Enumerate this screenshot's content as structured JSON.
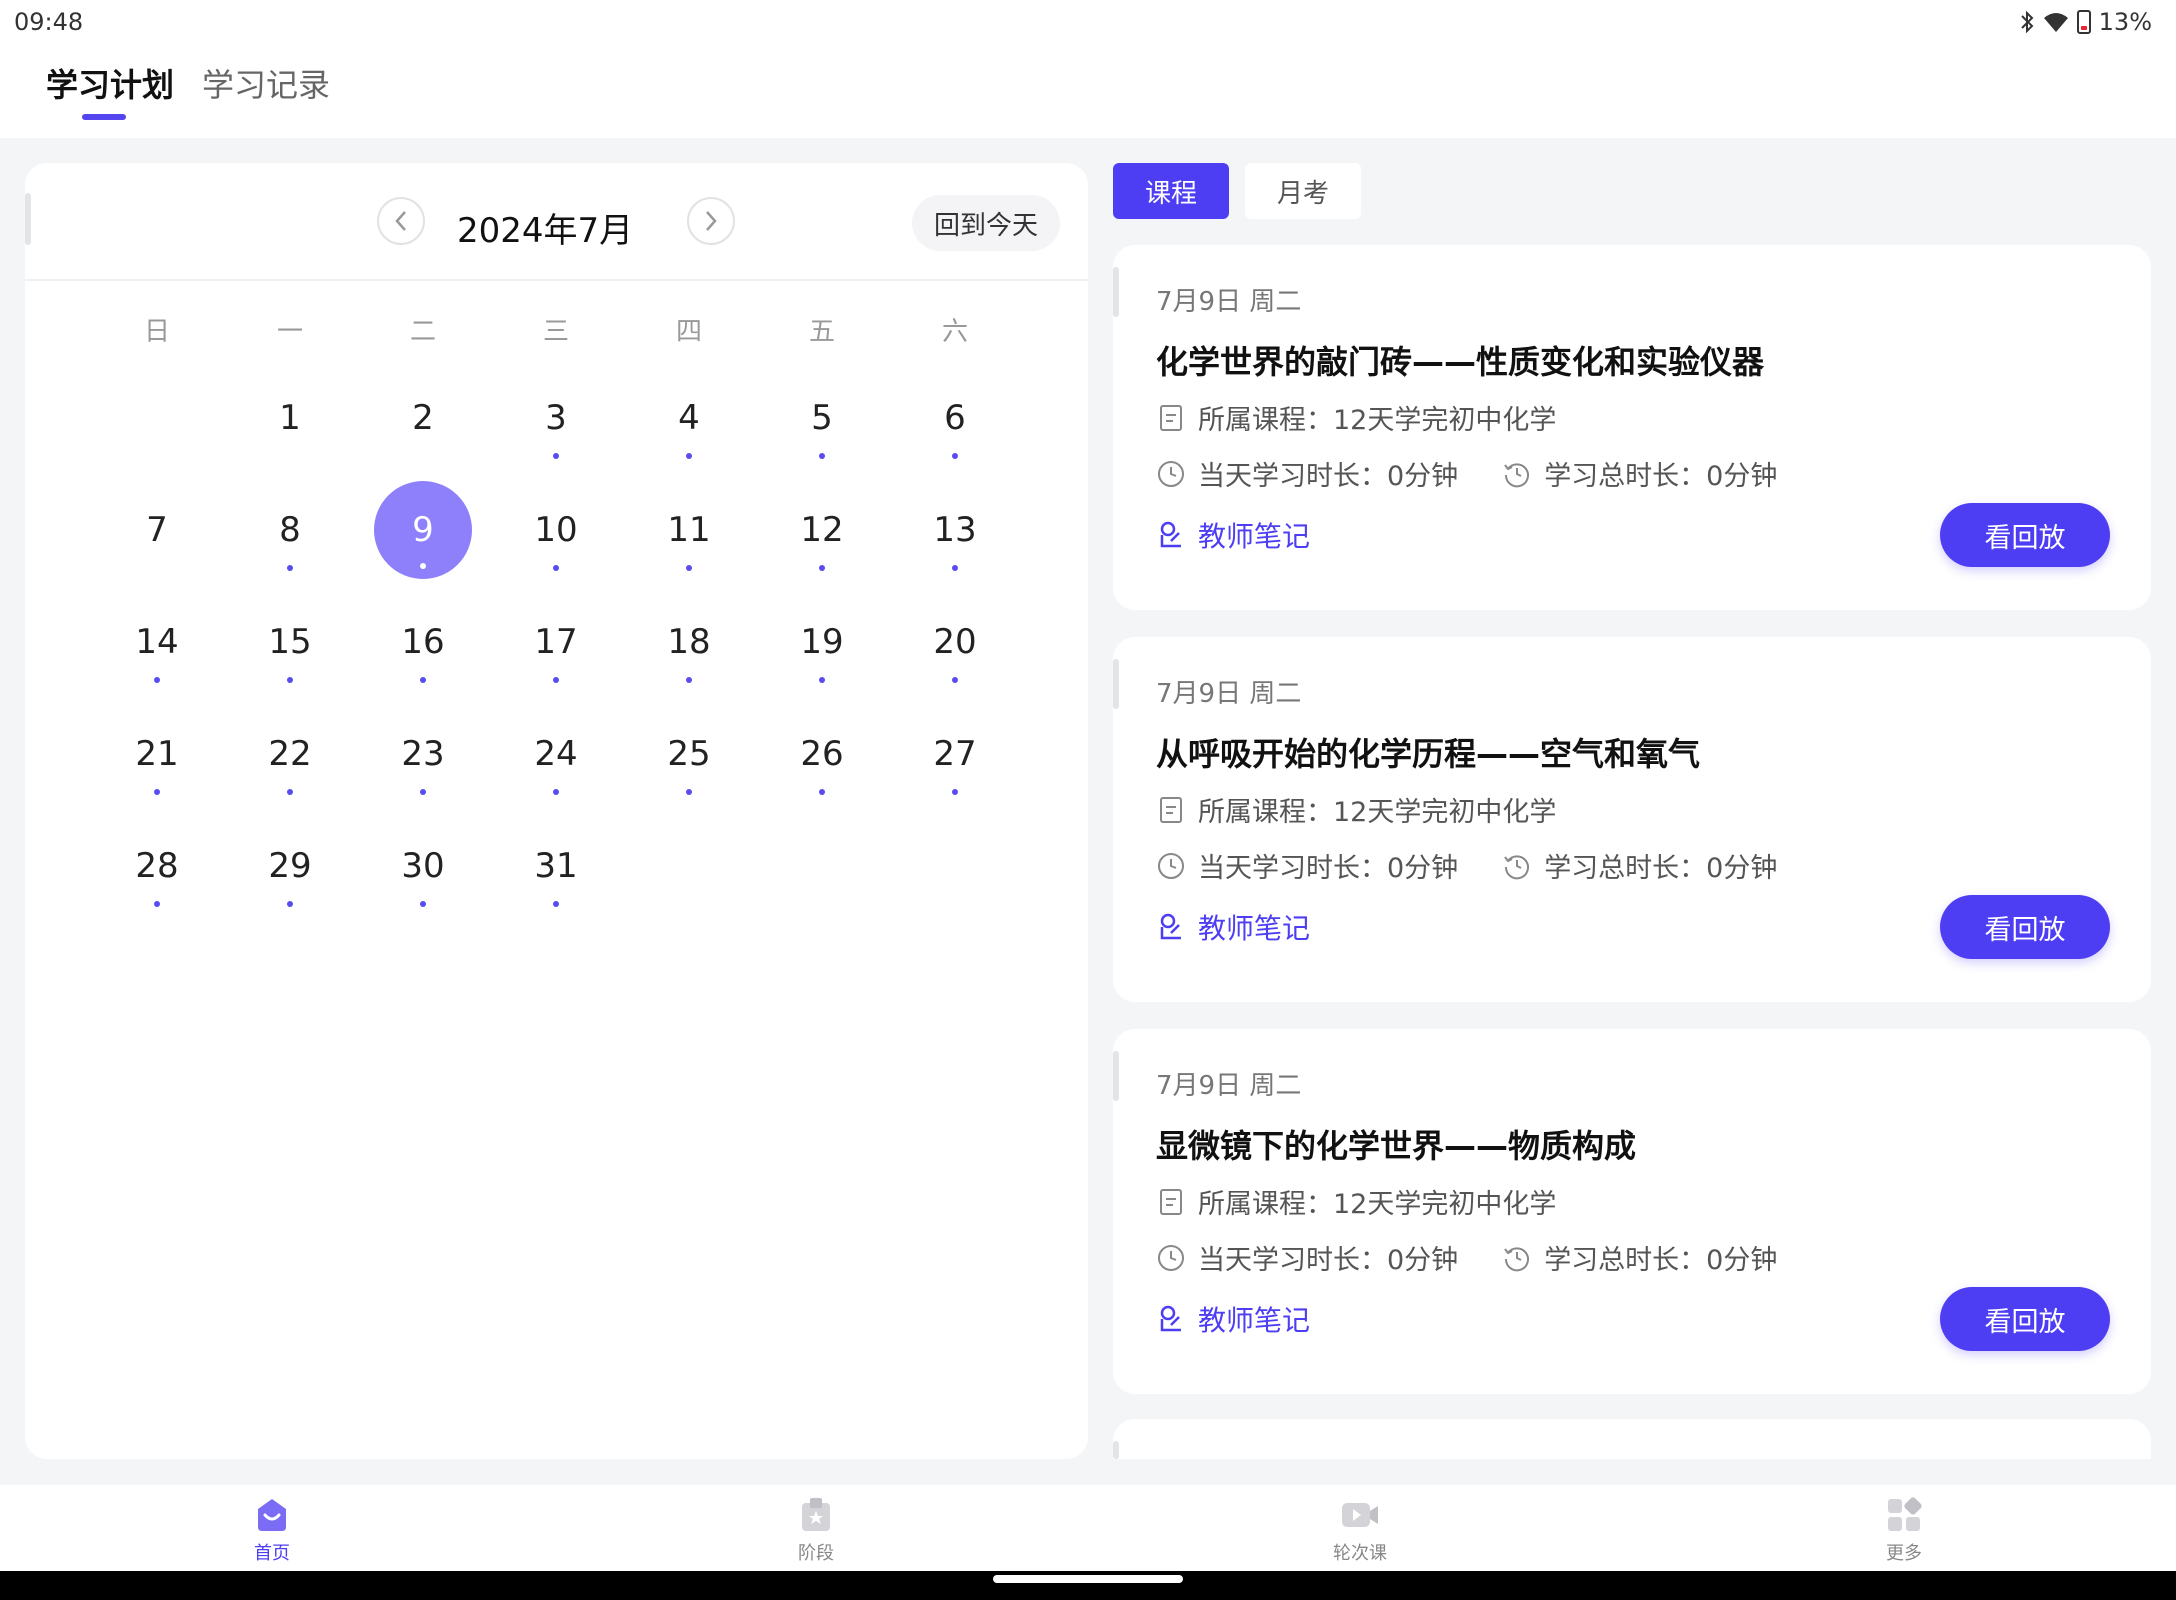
{
  "status_bar": {
    "time": "09:48",
    "battery": "13%"
  },
  "top_tabs": [
    {
      "label": "学习计划",
      "active": true
    },
    {
      "label": "学习记录",
      "active": false
    }
  ],
  "calendar": {
    "month_title": "2024年7月",
    "back_today": "回到今天",
    "weekdays": [
      "日",
      "一",
      "二",
      "三",
      "四",
      "五",
      "六"
    ],
    "selected_day": "9",
    "weeks": [
      [
        null,
        {
          "d": "1",
          "dot": false
        },
        {
          "d": "2",
          "dot": false
        },
        {
          "d": "3",
          "dot": true
        },
        {
          "d": "4",
          "dot": true
        },
        {
          "d": "5",
          "dot": true
        },
        {
          "d": "6",
          "dot": true
        }
      ],
      [
        {
          "d": "7",
          "dot": false
        },
        {
          "d": "8",
          "dot": true
        },
        {
          "d": "9",
          "dot": true
        },
        {
          "d": "10",
          "dot": true
        },
        {
          "d": "11",
          "dot": true
        },
        {
          "d": "12",
          "dot": true
        },
        {
          "d": "13",
          "dot": true
        }
      ],
      [
        {
          "d": "14",
          "dot": true
        },
        {
          "d": "15",
          "dot": true
        },
        {
          "d": "16",
          "dot": true
        },
        {
          "d": "17",
          "dot": true
        },
        {
          "d": "18",
          "dot": true
        },
        {
          "d": "19",
          "dot": true
        },
        {
          "d": "20",
          "dot": true
        }
      ],
      [
        {
          "d": "21",
          "dot": true
        },
        {
          "d": "22",
          "dot": true
        },
        {
          "d": "23",
          "dot": true
        },
        {
          "d": "24",
          "dot": true
        },
        {
          "d": "25",
          "dot": true
        },
        {
          "d": "26",
          "dot": true
        },
        {
          "d": "27",
          "dot": true
        }
      ],
      [
        {
          "d": "28",
          "dot": true
        },
        {
          "d": "29",
          "dot": true
        },
        {
          "d": "30",
          "dot": true
        },
        {
          "d": "31",
          "dot": true
        },
        null,
        null,
        null
      ]
    ]
  },
  "segment_tabs": [
    {
      "label": "课程",
      "active": true
    },
    {
      "label": "月考",
      "active": false
    }
  ],
  "courses": [
    {
      "date": "7月9日 周二",
      "title": "化学世界的敲门砖——性质变化和实验仪器",
      "course": "所属课程：12天学完初中化学",
      "today_duration": "当天学习时长：0分钟",
      "total_duration": "学习总时长：0分钟",
      "notes": "教师笔记",
      "replay": "看回放"
    },
    {
      "date": "7月9日 周二",
      "title": "从呼吸开始的化学历程——空气和氧气",
      "course": "所属课程：12天学完初中化学",
      "today_duration": "当天学习时长：0分钟",
      "total_duration": "学习总时长：0分钟",
      "notes": "教师笔记",
      "replay": "看回放"
    },
    {
      "date": "7月9日 周二",
      "title": "显微镜下的化学世界——物质构成",
      "course": "所属课程：12天学完初中化学",
      "today_duration": "当天学习时长：0分钟",
      "total_duration": "学习总时长：0分钟",
      "notes": "教师笔记",
      "replay": "看回放"
    }
  ],
  "bottom_nav": [
    {
      "label": "首页",
      "icon": "home-icon",
      "active": true
    },
    {
      "label": "阶段",
      "icon": "stage-icon",
      "active": false
    },
    {
      "label": "轮次课",
      "icon": "video-icon",
      "active": false
    },
    {
      "label": "更多",
      "icon": "grid-icon",
      "active": false
    }
  ],
  "colors": {
    "accent": "#4d3ef3",
    "selected_day": "#8e80fb",
    "background": "#f4f5f7"
  }
}
